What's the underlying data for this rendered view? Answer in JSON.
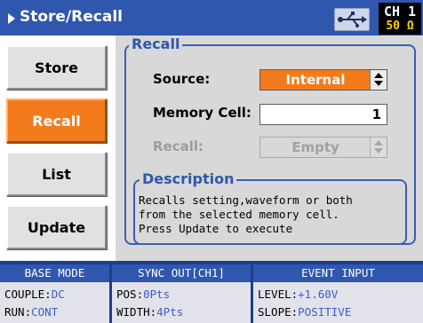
{
  "titlebar": {
    "title": "Store/Recall",
    "channel": "CH 1",
    "impedance": "50 Ω",
    "icons": [
      "arrow-right-icon",
      "usb-icon"
    ]
  },
  "sidebar": {
    "buttons": [
      {
        "label": "Store",
        "active": false
      },
      {
        "label": "Recall",
        "active": true
      },
      {
        "label": "List",
        "active": false
      },
      {
        "label": "Update",
        "active": false
      }
    ]
  },
  "recall_group": {
    "legend": "Recall",
    "source_label": "Source:",
    "source_value": "Internal",
    "memory_label": "Memory Cell:",
    "memory_value": "1",
    "recall_label": "Recall:",
    "recall_value": "Empty"
  },
  "description_group": {
    "legend": "Description",
    "lines": [
      "Recalls setting,waveform or both",
      "from the selected memory cell.",
      "Press Update to execute"
    ]
  },
  "status": {
    "base_mode": {
      "header": "BASE MODE",
      "couple_label": "COUPLE:",
      "couple_value": "DC",
      "run_label": "RUN:",
      "run_value": "CONT"
    },
    "sync_out": {
      "header": "SYNC OUT[CH1]",
      "pos_label": "POS:",
      "pos_value": "0Pts",
      "width_label": "WIDTH:",
      "width_value": "4Pts"
    },
    "event_input": {
      "header": "EVENT INPUT",
      "level_label": "LEVEL:",
      "level_value": "+1.60V",
      "slope_label": "SLOPE:",
      "slope_value": "POSITIVE"
    }
  },
  "colors": {
    "title_bar": "#2f57ad",
    "accent_orange": "#f37b1c",
    "panel_bg": "#d8d8d8",
    "status_bg": "#1d3e8c",
    "value_blue": "#3a5fc8"
  }
}
